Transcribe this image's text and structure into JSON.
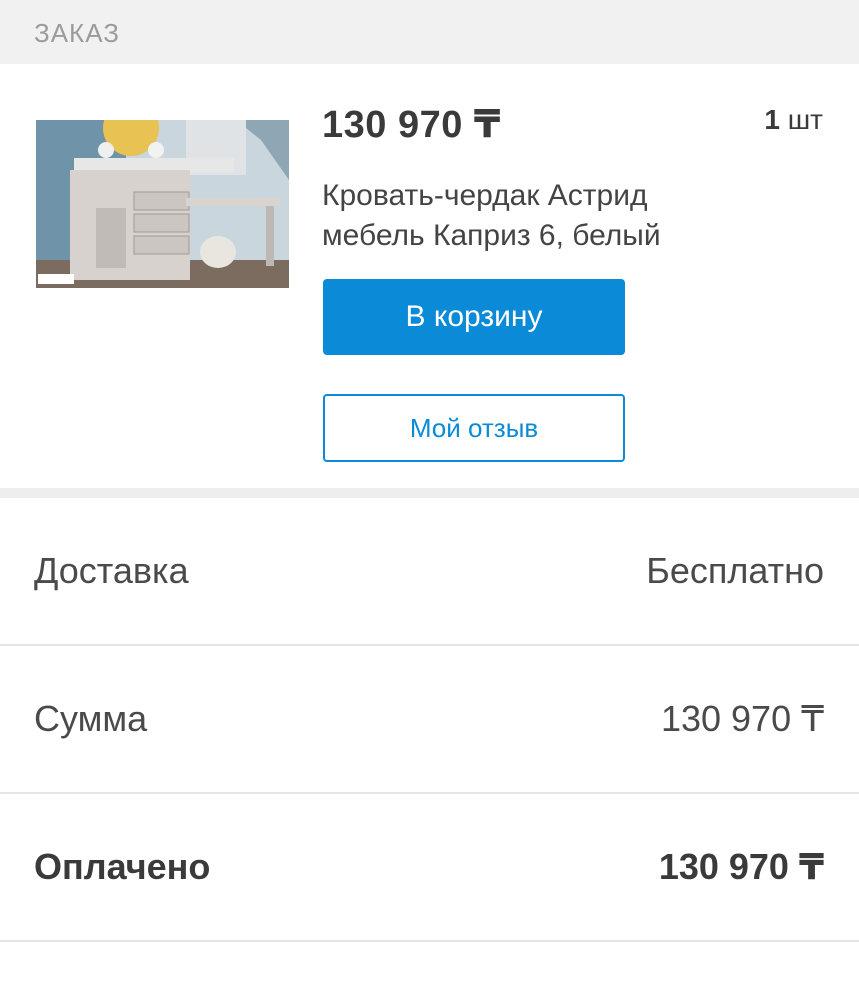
{
  "header": {
    "title": "ЗАКАЗ"
  },
  "product": {
    "price": "130 970 ₸",
    "qty_num": "1",
    "qty_unit": "шт",
    "name": "Кровать-чердак Астрид мебель Каприз 6, белый",
    "cart_button": "В корзину",
    "review_button": "Мой отзыв"
  },
  "summary": {
    "delivery_label": "Доставка",
    "delivery_value": "Бесплатно",
    "sum_label": "Сумма",
    "sum_value": "130 970 ₸",
    "paid_label": "Оплачено",
    "paid_value": "130 970 ₸"
  },
  "colors": {
    "accent": "#0b8ad8",
    "header_bg": "#f1f1f1",
    "text": "#444444"
  }
}
